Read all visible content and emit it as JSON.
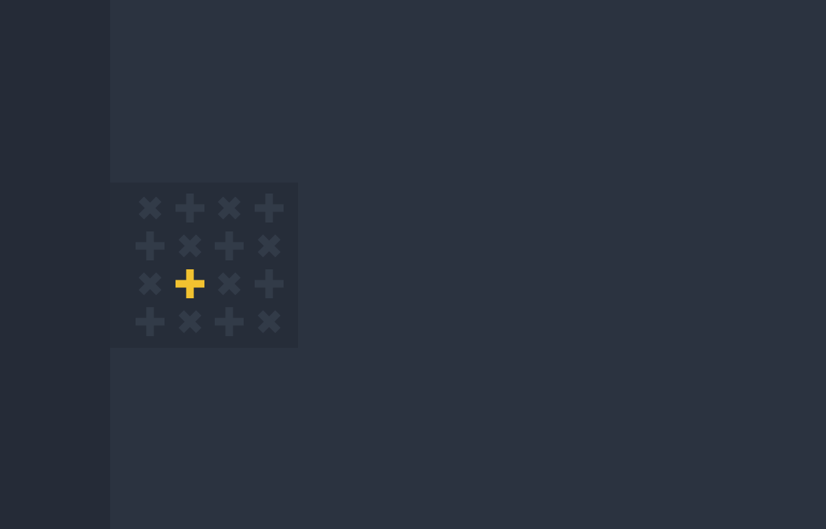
{
  "colors": {
    "sidebar_bg": "#252b37",
    "main_bg": "#2b3340",
    "panel_bg": "#262d39",
    "glyph_idle": "#323b48",
    "glyph_active": "#f2c230"
  },
  "grid": {
    "rows": 4,
    "cols": 4,
    "cells": [
      [
        "x-icon",
        "plus-icon",
        "x-icon",
        "plus-icon"
      ],
      [
        "plus-icon",
        "x-icon",
        "plus-icon",
        "x-icon"
      ],
      [
        "x-icon",
        "plus-icon",
        "x-icon",
        "plus-icon"
      ],
      [
        "plus-icon",
        "x-icon",
        "plus-icon",
        "x-icon"
      ]
    ],
    "selected": {
      "row": 2,
      "col": 1
    }
  }
}
